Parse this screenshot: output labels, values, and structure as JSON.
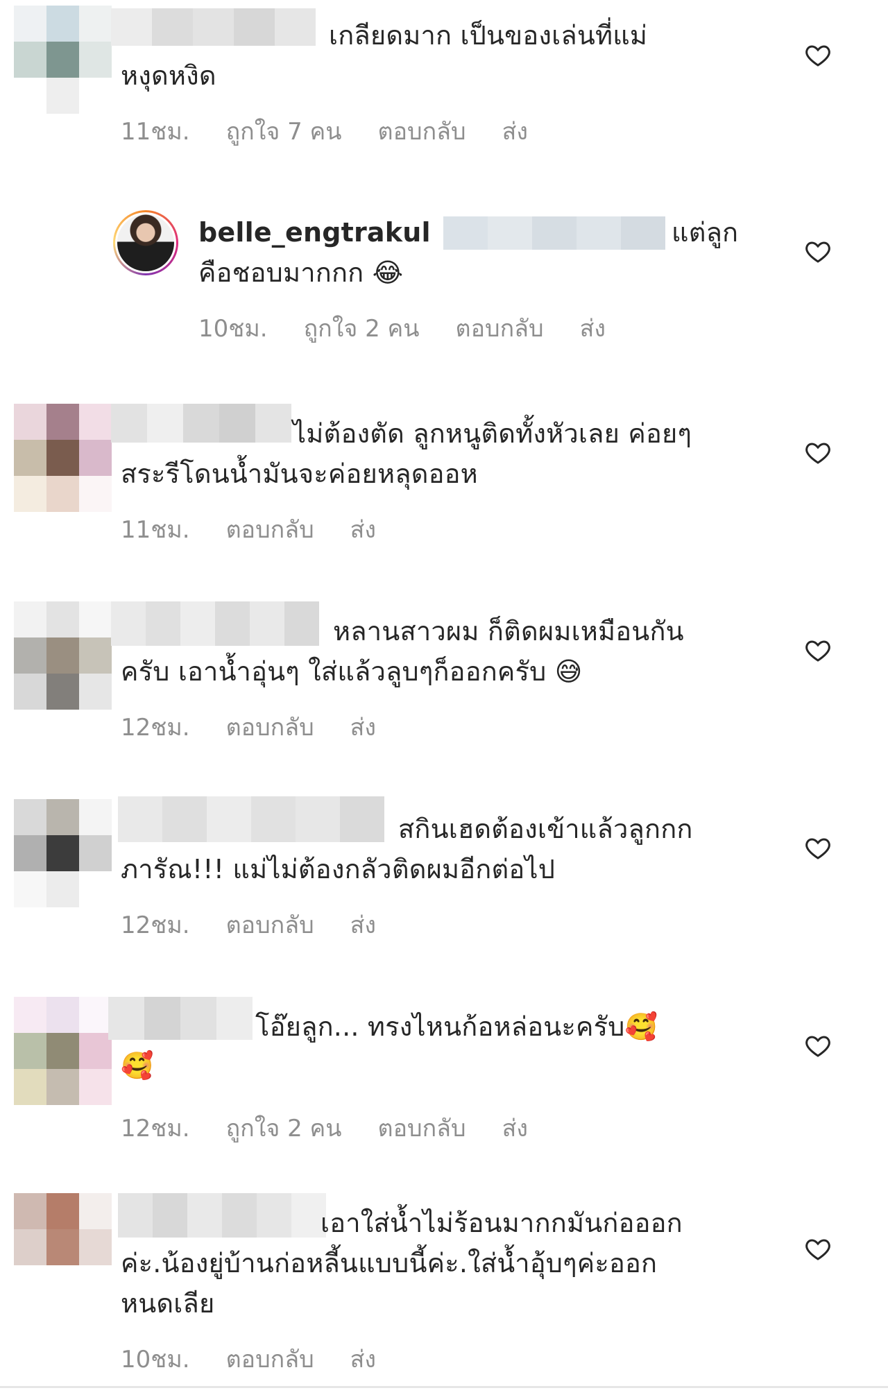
{
  "comments": [
    {
      "username": "",
      "text_line1": "เกลียดมาก เป็นของเล่นที่แม่",
      "text_line2": "หงุดหงิด",
      "time": "11ชม.",
      "likes": "ถูกใจ 7 คน",
      "reply": "ตอบกลับ",
      "send": "ส่ง"
    },
    {
      "username": "belle_engtrakul",
      "text_line1": "แต่ลูก",
      "text_line2": "คือชอบมากกก 😂",
      "time": "10ชม.",
      "likes": "ถูกใจ 2 คน",
      "reply": "ตอบกลับ",
      "send": "ส่ง"
    },
    {
      "username": "",
      "text_line1": "ไม่ต้องตัด ลูกหนูติดทั้งหัวเลย ค่อยๆ",
      "text_line2": "สระรีโดนน้ำมันจะค่อยหลุดออห",
      "time": "11ชม.",
      "reply": "ตอบกลับ",
      "send": "ส่ง"
    },
    {
      "username": "",
      "text_line1": "หลานสาวผม ก็ติดผมเหมือนกัน",
      "text_line2": "ครับ  เอาน้ำอุ่นๆ  ใส่แล้วลูบๆก็ออกครับ 😅",
      "time": "12ชม.",
      "reply": "ตอบกลับ",
      "send": "ส่ง"
    },
    {
      "username": "",
      "text_line1": "สกินเฮดต้องเข้าแล้วลูกกก",
      "text_line2": "ภารัณ!!! แม่ไม่ต้องกลัวติดผมอีกต่อไป",
      "time": "12ชม.",
      "reply": "ตอบกลับ",
      "send": "ส่ง"
    },
    {
      "username": "",
      "text_line1": "โอ๊ยลูก... ทรงไหนก้อหล่อนะครับ🥰",
      "text_line2": "🥰",
      "time": "12ชม.",
      "likes": "ถูกใจ 2 คน",
      "reply": "ตอบกลับ",
      "send": "ส่ง"
    },
    {
      "username": "",
      "text_line1": "เอาใส่น้ำไม่ร้อนมากกมันก่อออก",
      "text_line2": "ค่ะ.น้องยู่บ้านก่อหลี้นแบบนี้ค่ะ.ใส่น้ำอุ้บๆค่ะออก",
      "text_line3": "หนดเลีย",
      "time": "10ชม.",
      "reply": "ตอบกลับ",
      "send": "ส่ง"
    }
  ],
  "icons": {
    "like": "heart-outline-icon"
  },
  "colors": {
    "text": "#262626",
    "meta": "#8e8e8e",
    "heart": "#262626"
  }
}
